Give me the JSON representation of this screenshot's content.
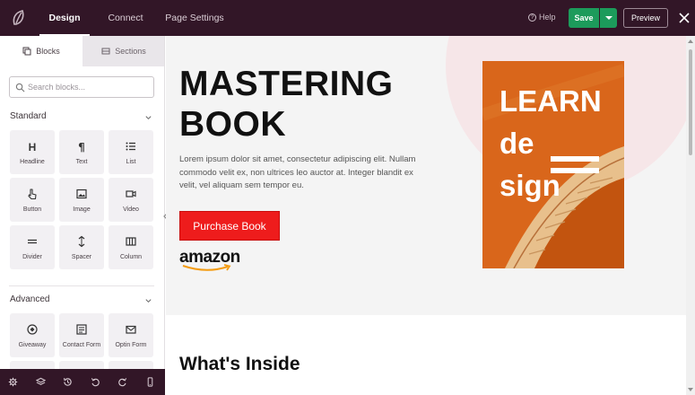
{
  "topbar": {
    "tabs": [
      {
        "label": "Design",
        "active": true
      },
      {
        "label": "Connect",
        "active": false
      },
      {
        "label": "Page Settings",
        "active": false
      }
    ],
    "help_label": "Help",
    "save_label": "Save",
    "preview_label": "Preview",
    "colors": {
      "bar": "#321627",
      "save": "#1c9b5b"
    }
  },
  "sidebar": {
    "tabs": [
      {
        "label": "Blocks",
        "icon": "blocks-icon",
        "active": true
      },
      {
        "label": "Sections",
        "icon": "sections-icon",
        "active": false
      }
    ],
    "search_placeholder": "Search blocks...",
    "groups": [
      {
        "title": "Standard",
        "blocks": [
          {
            "label": "Headline",
            "icon": "headline-icon"
          },
          {
            "label": "Text",
            "icon": "paragraph-icon"
          },
          {
            "label": "List",
            "icon": "list-icon"
          },
          {
            "label": "Button",
            "icon": "pointer-icon"
          },
          {
            "label": "Image",
            "icon": "image-icon"
          },
          {
            "label": "Video",
            "icon": "video-icon"
          },
          {
            "label": "Divider",
            "icon": "divider-icon"
          },
          {
            "label": "Spacer",
            "icon": "spacer-icon"
          },
          {
            "label": "Column",
            "icon": "column-icon"
          }
        ]
      },
      {
        "title": "Advanced",
        "blocks": [
          {
            "label": "Giveaway",
            "icon": "giveaway-icon"
          },
          {
            "label": "Contact Form",
            "icon": "contact-form-icon"
          },
          {
            "label": "Optin Form",
            "icon": "mail-icon"
          }
        ]
      }
    ]
  },
  "bottom_toolbar": [
    "settings-icon",
    "layers-icon",
    "history-icon",
    "undo-icon",
    "redo-icon",
    "mobile-preview-icon"
  ],
  "page": {
    "hero_title": "MASTERING\nBOOK",
    "hero_title_line1": "MASTERING",
    "hero_title_line2": "BOOK",
    "hero_text": "Lorem ipsum dolor sit amet, consectetur adipiscing elit. Nullam commodo velit ex, non ultrices leo auctor at. Integer blandit ex velit, vel aliquam sem tempor eu.",
    "button_label": "Purchase Book",
    "amazon_logo": "amazon",
    "book_cover": {
      "line1": "LEARN",
      "line2": "de",
      "line3": "sign",
      "color": "#d9651a"
    },
    "section_title": "What's Inside",
    "colors": {
      "button": "#ee1c1c",
      "hero_bg": "#f4f4f4",
      "circle": "#f6e6e8"
    }
  }
}
